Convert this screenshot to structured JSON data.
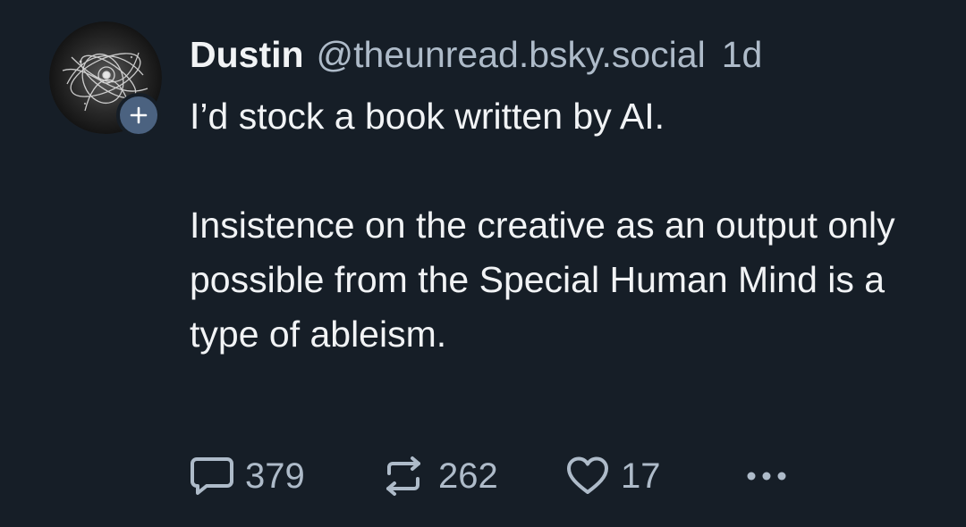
{
  "post": {
    "author": {
      "display_name": "Dustin",
      "handle": "@theunread.bsky.social",
      "avatar_icon": "abstract-light-swirl-avatar",
      "follow_icon": "plus-icon"
    },
    "timestamp": "1d",
    "text": {
      "line1": "I’d stock a book written by AI.",
      "line2": "Insistence on the creative as an output only possible from the Special Human Mind is a type of ableism."
    },
    "actions": {
      "reply": {
        "icon": "reply-bubble-icon",
        "count": "379"
      },
      "repost": {
        "icon": "repost-arrows-icon",
        "count": "262"
      },
      "like": {
        "icon": "heart-icon",
        "count": "17"
      },
      "more": {
        "icon": "more-ellipsis-icon"
      }
    }
  },
  "colors": {
    "background": "#161e27",
    "text_primary": "#f1f3f5",
    "text_secondary": "#aebbc9",
    "badge": "#4b6280"
  }
}
